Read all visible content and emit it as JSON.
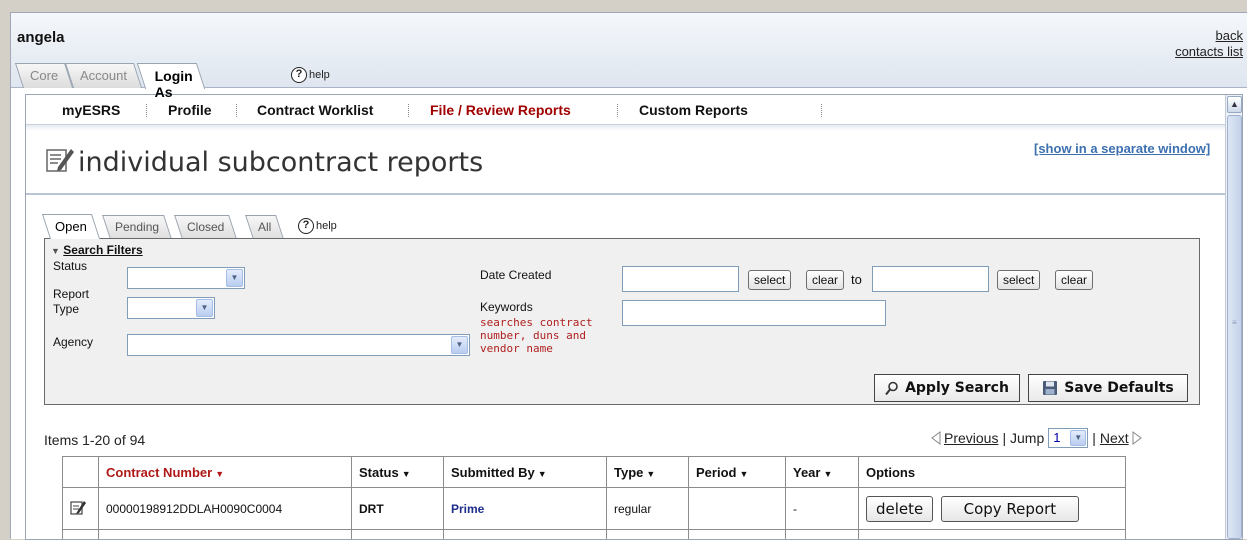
{
  "header": {
    "username": "angela",
    "links": [
      "back",
      "contacts list"
    ],
    "tabs": [
      {
        "label": "Core",
        "active": false
      },
      {
        "label": "Account",
        "active": false
      },
      {
        "label": "Login As",
        "active": true
      }
    ],
    "help_label": "help"
  },
  "menu": {
    "items": [
      {
        "label": "myESRS",
        "selected": false
      },
      {
        "label": "Profile",
        "selected": false
      },
      {
        "label": "Contract Worklist",
        "selected": false
      },
      {
        "label": "File / Review Reports",
        "selected": true
      },
      {
        "label": "Custom Reports",
        "selected": false
      }
    ]
  },
  "page": {
    "title": "individual subcontract reports",
    "separate_window_link": "[show in a separate window]"
  },
  "subtabs": {
    "items": [
      {
        "label": "Open",
        "active": true
      },
      {
        "label": "Pending",
        "active": false
      },
      {
        "label": "Closed",
        "active": false
      },
      {
        "label": "All",
        "active": false
      }
    ],
    "help_label": "help"
  },
  "filters": {
    "toggle_label": "Search Filters",
    "status_label": "Status",
    "status_value": "",
    "report_type_label": "Report Type",
    "report_type_value": "",
    "agency_label": "Agency",
    "agency_value": "",
    "date_created_label": "Date Created",
    "date_from_value": "",
    "date_to_value": "",
    "select_label": "select",
    "clear_label": "clear",
    "to_label": "to",
    "keywords_label": "Keywords",
    "keywords_hint": "searches contract number, duns and vendor name",
    "keywords_value": "",
    "apply_label": "Apply Search",
    "save_defaults_label": "Save Defaults"
  },
  "list": {
    "items_count": "Items 1-20 of 94",
    "previous_label": "Previous",
    "jump_label": "| Jump",
    "jump_value": "1",
    "next_label": "Next",
    "next_prefix": "|"
  },
  "table": {
    "columns": [
      "Contract Number",
      "Status",
      "Submitted By",
      "Type",
      "Period",
      "Year",
      "Options"
    ],
    "rows": [
      {
        "contract_number": "00000198912DDLAH0090C0004",
        "status": "DRT",
        "submitted_by": "Prime",
        "type": "regular",
        "period": "",
        "year": "-",
        "delete_label": "delete",
        "copy_label": "Copy Report"
      }
    ]
  },
  "colors": {
    "selected_menu": "#a00000",
    "link_blue": "#3c6fb0",
    "hint_red": "#b02020"
  },
  "icons": [
    "help-icon",
    "edit-report-icon",
    "magnifier-icon",
    "floppy-disk-icon",
    "edit-row-icon"
  ]
}
